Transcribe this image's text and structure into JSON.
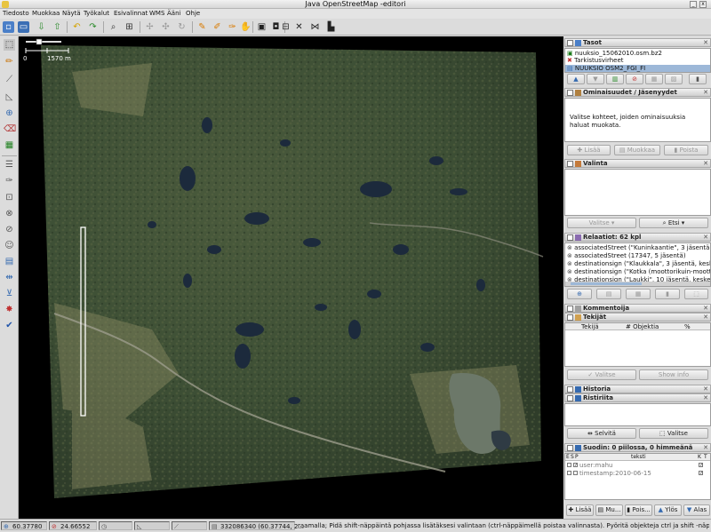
{
  "window": {
    "title": "Java OpenStreetMap -editori"
  },
  "menu": [
    "Tiedosto",
    "Muokkaa",
    "Näytä",
    "Työkalut",
    "Esivalinnat",
    "WMS",
    "Ääni",
    "Ohje"
  ],
  "map": {
    "scale_start": "0",
    "scale_end": "1570 m"
  },
  "layers": {
    "title": "Tasot",
    "items": [
      "nuuksio_15062010.osm.bz2",
      "Tarkistusvirheet",
      "NUUKSIO OSM2_FGI_FI"
    ]
  },
  "properties": {
    "title": "Ominaisuudet / Jäsenyydet",
    "message": "Valitse kohteet, joiden ominaisuuksia haluat muokata.",
    "buttons": [
      "Lisää",
      "Muokkaa",
      "Poista"
    ]
  },
  "selection": {
    "title": "Valinta",
    "buttons": [
      "Valitse",
      "Etsi"
    ]
  },
  "relations": {
    "title": "Relaatiot: 62 kpl",
    "items": [
      "associatedStreet (\"Kuninkaantie\", 3 jäsentä, ke",
      "associatedStreet (17347, 5 jäsentä)",
      "destinationsign (\"Klaukkala\", 3 jäsentä, keske",
      "destinationsign (\"Kotka (moottorikuin-mootto",
      "destinationsign (\"Laukki\", 10 jäsentä, keskene"
    ]
  },
  "comments": {
    "title": "Kommentoija"
  },
  "authors": {
    "title": "Tekijät",
    "columns": [
      "Tekijä",
      "# Objektia",
      "%"
    ],
    "buttons": [
      "Valitse",
      "Show info"
    ]
  },
  "history": {
    "title": "Historia"
  },
  "conflicts": {
    "title": "Ristiriita",
    "buttons": [
      "Selvitä",
      "Valitse"
    ]
  },
  "filter": {
    "title": "Suodin: 0 piilossa, 0 himmeänä",
    "columns": [
      "E",
      "S",
      "P",
      "teksti",
      "K",
      "T"
    ],
    "rows": [
      "user:mahu",
      "timestamp:2010-06-15"
    ],
    "buttons": [
      "Lisää",
      "Mu...",
      "Pois...",
      "Ylös",
      "Alas"
    ]
  },
  "status": {
    "lat": "60.37780",
    "lon": "24.66552",
    "way": "332086340 (60.37744, 2...",
    "hint": "raamalla; Pidä shift-näppäintä pohjassa lisätäksesi valintaan (ctrl-näppäimellä poistaa valinnasta). Pyöritä objekteja ctrl ja shift -näppäimellä pohjassa raahamalla."
  }
}
